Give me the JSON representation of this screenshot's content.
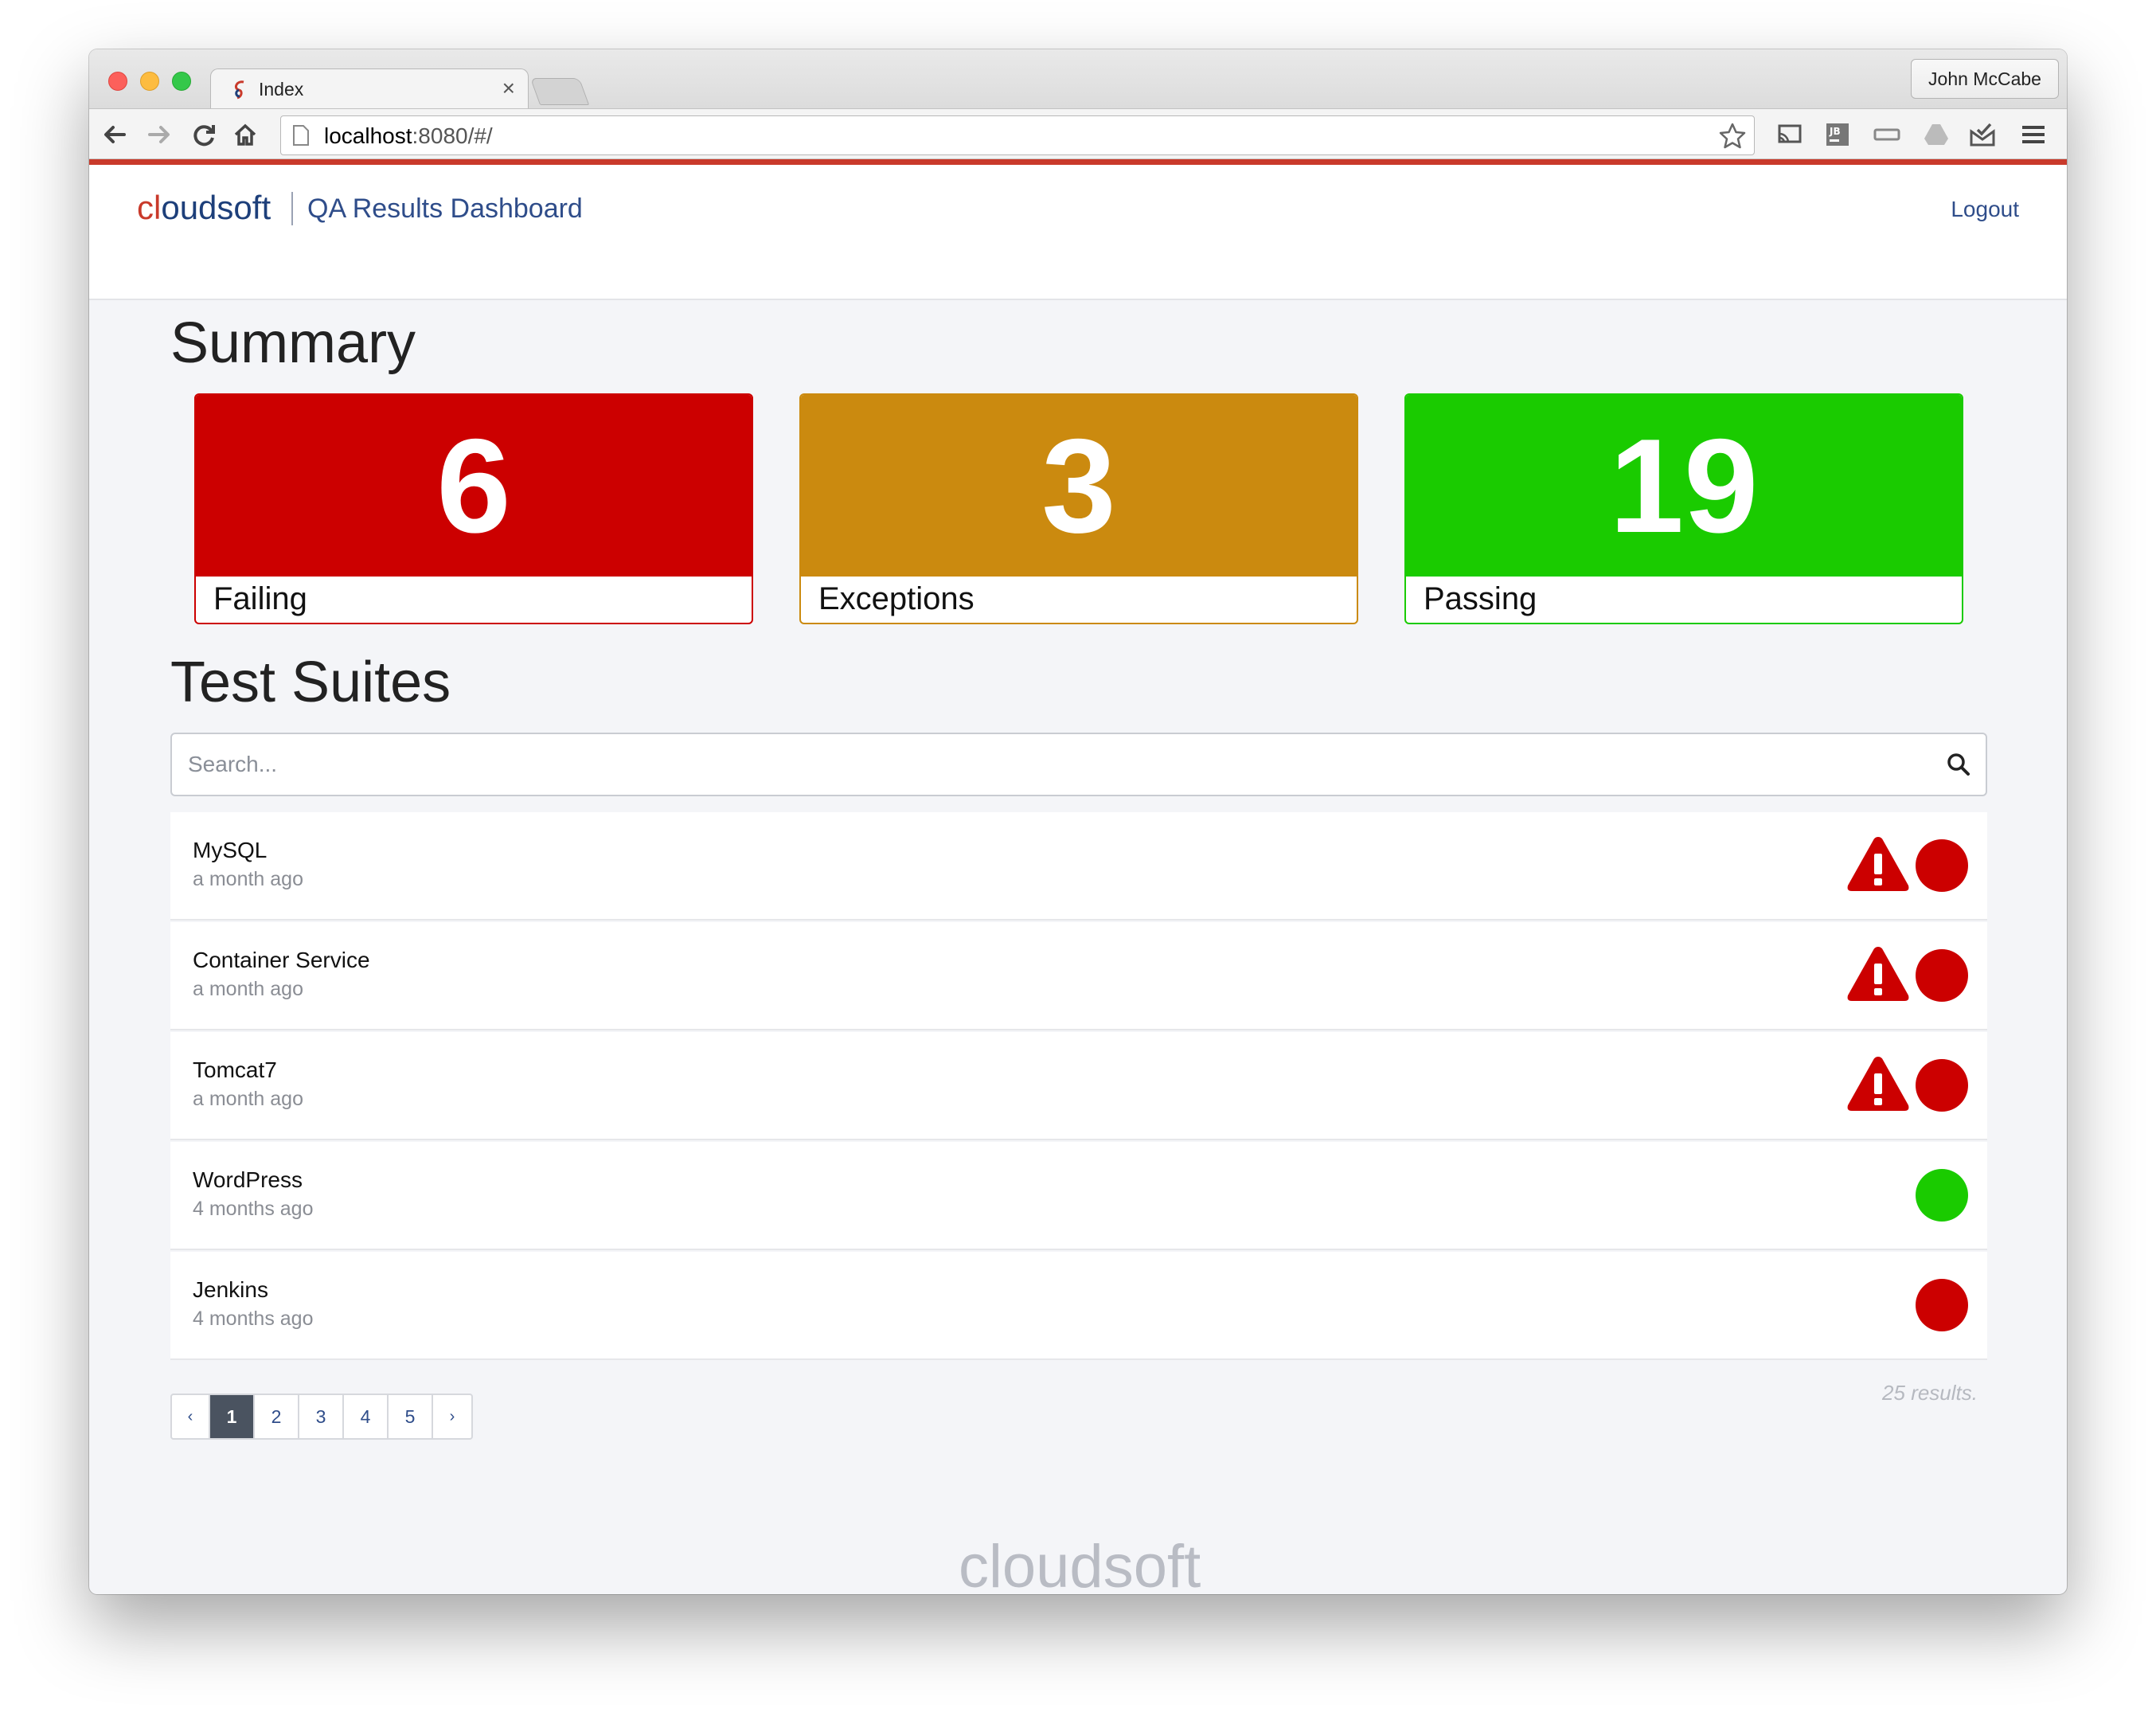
{
  "browser": {
    "tab_title": "Index",
    "tab_close": "×",
    "profile_name": "John McCabe",
    "url_host": "localhost",
    "url_rest": ":8080/#/"
  },
  "header": {
    "logo_part1": "cl",
    "logo_part2": "oudsoft",
    "app_title": "QA Results Dashboard",
    "logout_label": "Logout"
  },
  "summary": {
    "heading": "Summary",
    "cards": [
      {
        "value": "6",
        "label": "Failing",
        "color": "#cc0000"
      },
      {
        "value": "3",
        "label": "Exceptions",
        "color": "#cb8a0f"
      },
      {
        "value": "19",
        "label": "Passing",
        "color": "#1acb00"
      }
    ]
  },
  "suites": {
    "heading": "Test Suites",
    "search_placeholder": "Search...",
    "items": [
      {
        "name": "MySQL",
        "time": "a month ago",
        "warning": true,
        "status": "failing"
      },
      {
        "name": "Container Service",
        "time": "a month ago",
        "warning": true,
        "status": "failing"
      },
      {
        "name": "Tomcat7",
        "time": "a month ago",
        "warning": true,
        "status": "failing"
      },
      {
        "name": "WordPress",
        "time": "4 months ago",
        "warning": false,
        "status": "passing"
      },
      {
        "name": "Jenkins",
        "time": "4 months ago",
        "warning": false,
        "status": "failing"
      }
    ],
    "results_text": "25 results."
  },
  "pagination": {
    "prev": "‹",
    "pages": [
      "1",
      "2",
      "3",
      "4",
      "5"
    ],
    "active_page": "1",
    "next": "›"
  },
  "footer": {
    "logo_text": "cloudsoft"
  },
  "colors": {
    "accent": "#c93a2b",
    "failing": "#cc0000",
    "exception": "#cb8a0f",
    "passing": "#1acb00"
  }
}
